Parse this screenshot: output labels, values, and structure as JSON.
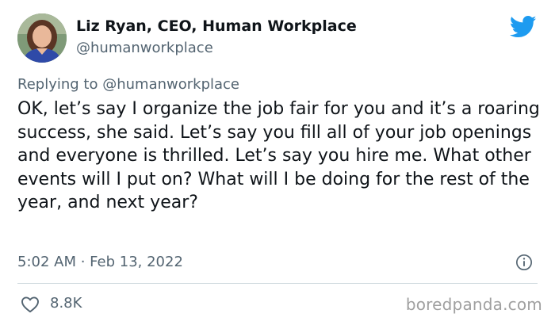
{
  "author": {
    "display_name": "Liz Ryan, CEO, Human Workplace",
    "handle": "@humanworkplace"
  },
  "reply": {
    "prefix": "Replying to",
    "mention": "@humanworkplace"
  },
  "tweet": {
    "text": "OK, let’s say I organize the job fair for you and it’s a roaring success, she said. Let’s say you fill all of your job openings and everyone is thrilled. Let’s say you hire me. What other events will I put on? What will I be doing for the rest of the year, and next year?",
    "timestamp": "5:02 AM · Feb 13, 2022",
    "likes": "8.8K"
  },
  "watermark": "boredpanda.com",
  "colors": {
    "twitter_blue": "#1d9bf0",
    "secondary_text": "#536471",
    "primary_text": "#0f1419"
  },
  "icons": {
    "brand": "twitter-bird-icon",
    "info": "info-icon",
    "like": "heart-icon"
  }
}
